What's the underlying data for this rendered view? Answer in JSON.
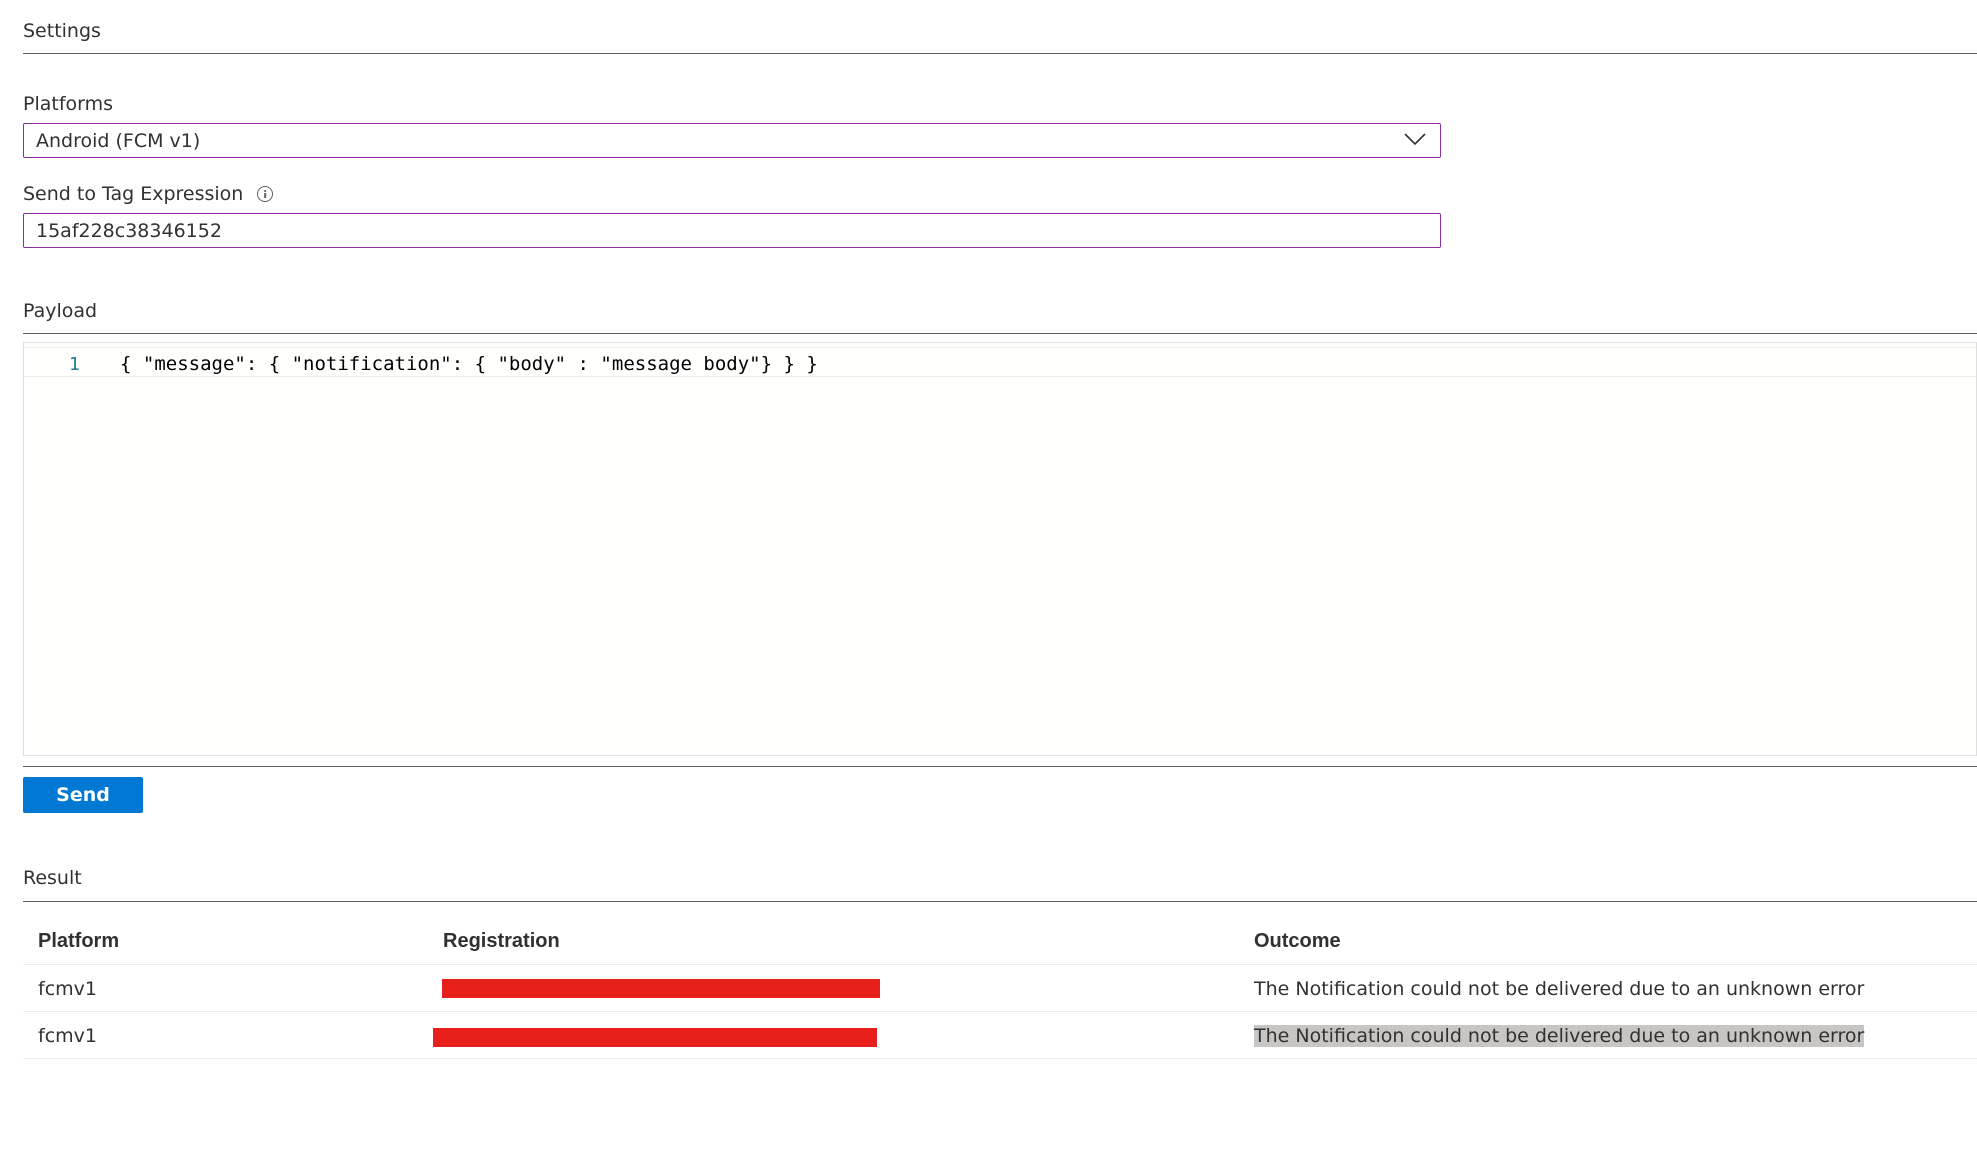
{
  "settings": {
    "title": "Settings"
  },
  "platforms": {
    "label": "Platforms",
    "selected": "Android (FCM v1)"
  },
  "tag_expression": {
    "label": "Send to Tag Expression",
    "value": "15af228c38346152"
  },
  "payload": {
    "title": "Payload",
    "lines": [
      {
        "number": "1",
        "code": "{ \"message\": { \"notification\": { \"body\" : \"message body\"} } }"
      }
    ]
  },
  "send_button": {
    "label": "Send",
    "color": "#0078d4"
  },
  "result": {
    "title": "Result",
    "columns": [
      "Platform",
      "Registration",
      "Outcome"
    ],
    "rows": [
      {
        "platform": "fcmv1",
        "registration": "",
        "outcome": "The Notification could not be delivered due to an unknown error",
        "redacted": true,
        "outcome_selected": false
      },
      {
        "platform": "fcmv1",
        "registration": "",
        "outcome": "The Notification could not be delivered due to an unknown error",
        "redacted": true,
        "outcome_selected": true
      }
    ]
  },
  "colors": {
    "input_border": "#8a2da5",
    "redaction": "#e8201c",
    "line_number": "#237893"
  }
}
